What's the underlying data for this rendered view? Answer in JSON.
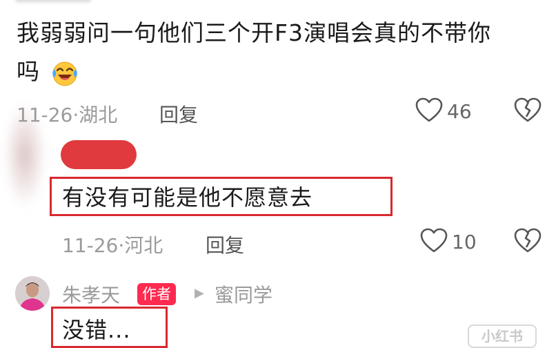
{
  "comment1": {
    "text_line1": "我弱弱问一句他们三个开F3演唱会真的不带你",
    "text_line2": "吗",
    "emoji": "laughing-crying-emoji",
    "date_location": "11-26·湖北",
    "reply_label": "回复",
    "like_count": "46"
  },
  "comment2": {
    "text": "有没有可能是他不愿意去",
    "date_location": "11-26·河北",
    "reply_label": "回复",
    "like_count": "10"
  },
  "comment3": {
    "username": "朱孝天",
    "author_badge": "作者",
    "reply_arrow": "▶",
    "reply_to": "蜜同学",
    "text": "没错..."
  },
  "watermark": "小红书",
  "colors": {
    "highlight_box": "#d9282f",
    "redaction": "#e03a3e",
    "author_badge_bg": "#ff2a50"
  }
}
